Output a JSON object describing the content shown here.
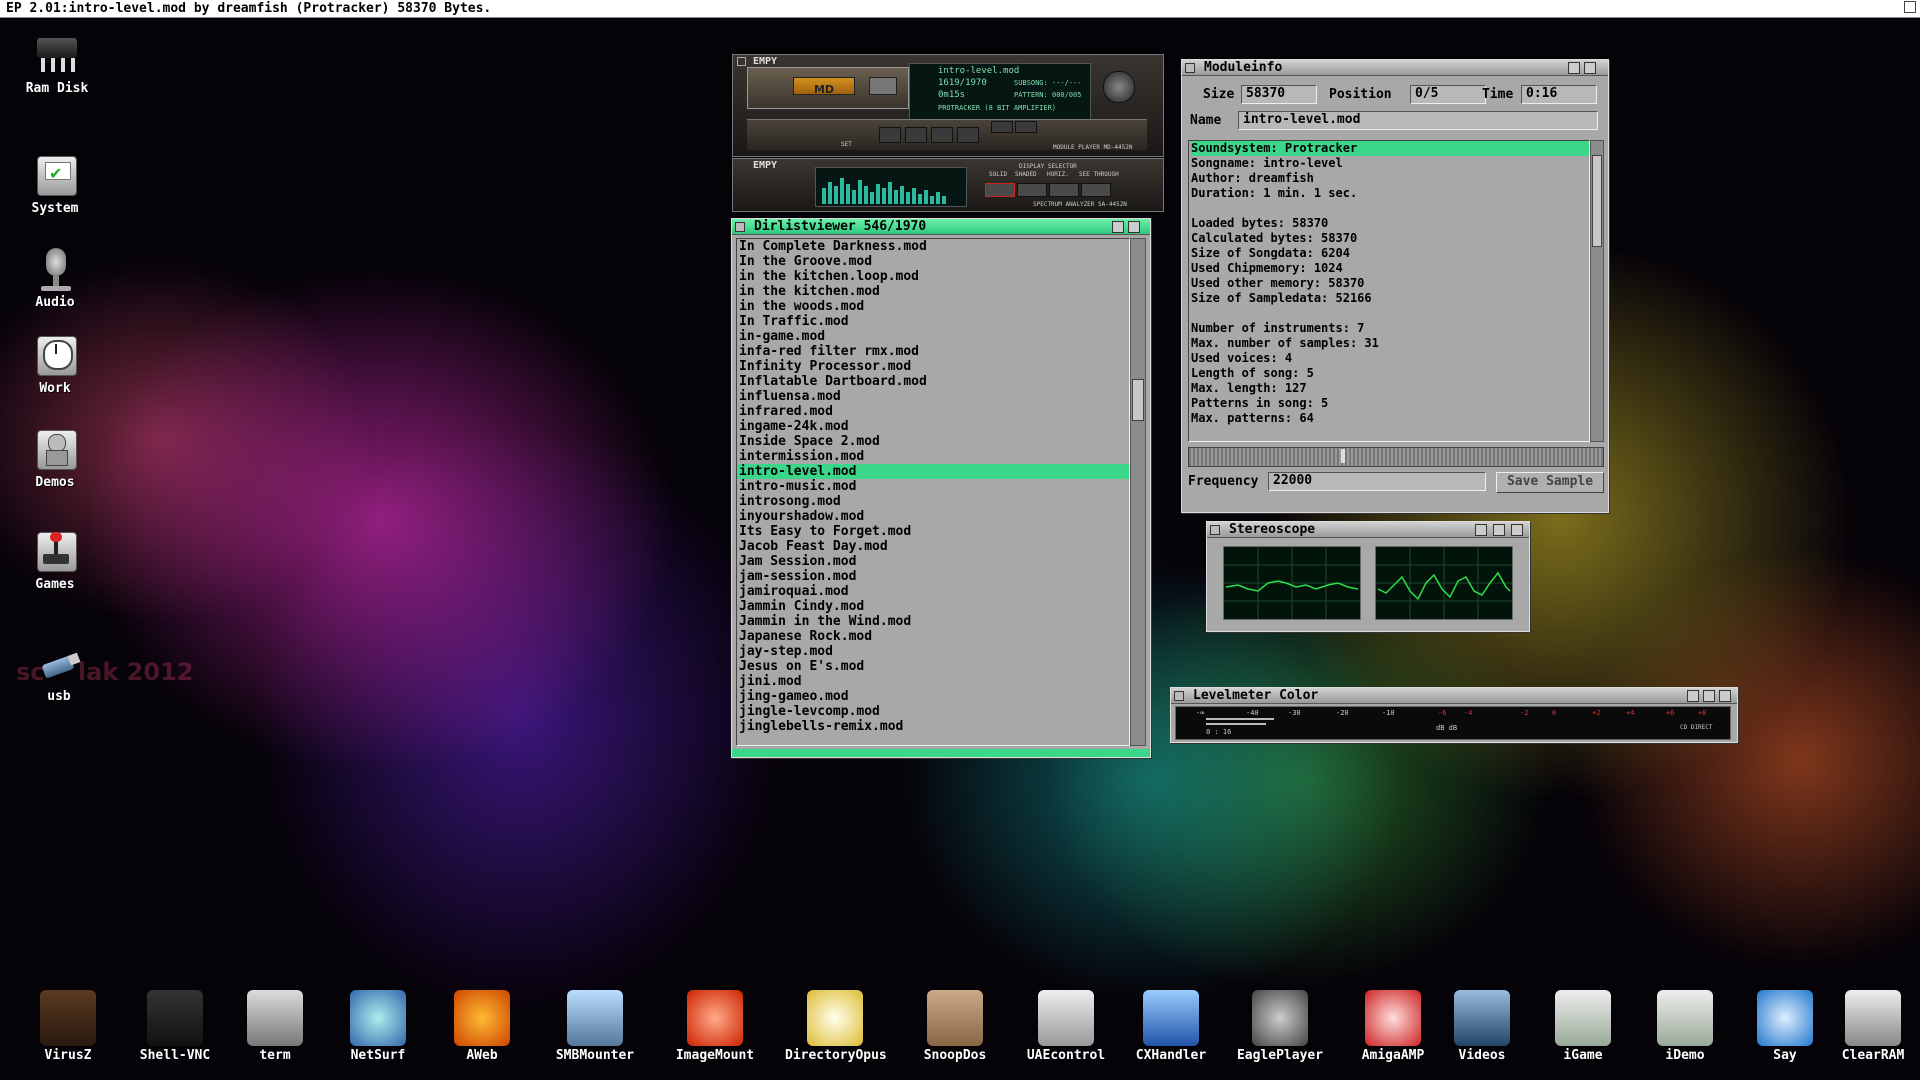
{
  "topbar": {
    "title": "EP 2.01:intro-level.mod by dreamfish (Protracker) 58370 Bytes."
  },
  "desktop_icons": [
    {
      "label": "Ram Disk",
      "icon": "chip-icon"
    },
    {
      "label": "System",
      "icon": "system-disk-icon"
    },
    {
      "label": "Audio",
      "icon": "microphone-icon"
    },
    {
      "label": "Work",
      "icon": "clock-drive-icon"
    },
    {
      "label": "Demos",
      "icon": "robot-icon"
    },
    {
      "label": "Games",
      "icon": "joystick-icon"
    },
    {
      "label": "usb",
      "icon": "usb-stick-icon"
    }
  ],
  "wallpaper_text": "sc    lak 2012",
  "dock": [
    {
      "label": "VirusZ"
    },
    {
      "label": "Shell-VNC"
    },
    {
      "label": "term"
    },
    {
      "label": "NetSurf"
    },
    {
      "label": "AWeb"
    },
    {
      "label": "SMBMounter"
    },
    {
      "label": "ImageMount"
    },
    {
      "label": "DirectoryOpus"
    },
    {
      "label": "SnoopDos"
    },
    {
      "label": "UAEcontrol"
    },
    {
      "label": "CXHandler"
    },
    {
      "label": "EaglePlayer"
    },
    {
      "label": "AmigaAMP"
    },
    {
      "label": "Videos"
    },
    {
      "label": "iGame"
    },
    {
      "label": "iDemo"
    },
    {
      "label": "Say"
    },
    {
      "label": "ClearRAM"
    }
  ],
  "player": {
    "brand": "EMPY",
    "md_label": "MD",
    "lcd_title": "intro-level.mod",
    "lcd_count": "1619/1970",
    "lcd_subsong_label": "SUBSONG:",
    "lcd_subsong": "---/---",
    "lcd_time": "0m15s",
    "lcd_pattern_label": "PATTERN:",
    "lcd_pattern": "000/005",
    "lcd_format": "PROTRACKER (8 BIT AMPLIFIER)",
    "model": "MODULE PLAYER MD-4452N",
    "analyzer_model": "SPECTRUM ANALYZER SA-4452N",
    "set_label": "SET",
    "display_select": "DISPLAY SELECTOR",
    "mode_labels": [
      "SOLID",
      "SHADED",
      "HORIZ.",
      "SEE THROUGH"
    ]
  },
  "dirlist": {
    "title": "Dirlistviewer 546/1970",
    "rows": [
      "In Complete Darkness.mod",
      "In the Groove.mod",
      "in the kitchen.loop.mod",
      "in the kitchen.mod",
      "in the woods.mod",
      "In Traffic.mod",
      "in-game.mod",
      "infa-red filter rmx.mod",
      "Infinity Processor.mod",
      "Inflatable Dartboard.mod",
      "influensa.mod",
      "infrared.mod",
      "ingame-24k.mod",
      "Inside Space 2.mod",
      "intermission.mod",
      "intro-level.mod",
      "intro-music.mod",
      "introsong.mod",
      "inyourshadow.mod",
      "Its Easy to Forget.mod",
      "Jacob Feast Day.mod",
      "Jam Session.mod",
      "jam-session.mod",
      "jamiroquai.mod",
      "Jammin Cindy.mod",
      "Jammin in the Wind.mod",
      "Japanese Rock.mod",
      "jay-step.mod",
      "Jesus on E's.mod",
      "jini.mod",
      "jing-gameo.mod",
      "jingle-levcomp.mod",
      "jinglebells-remix.mod"
    ],
    "selected_index": 15
  },
  "moduleinfo": {
    "title": "Moduleinfo",
    "size_label": "Size",
    "size": "58370",
    "position_label": "Position",
    "position": "0/5",
    "time_label": "Time",
    "time": "0:16",
    "name_label": "Name",
    "name": "intro-level.mod",
    "info_lines": [
      "Soundsystem: Protracker",
      "Songname: intro-level",
      "Author: dreamfish",
      "Duration: 1 min. 1 sec.",
      "",
      "Loaded bytes: 58370",
      "Calculated bytes: 58370",
      "Size of Songdata: 6204",
      "Used Chipmemory: 1024",
      "Used other memory: 58370",
      "Size of Sampledata: 52166",
      "",
      "Number of instruments: 7",
      "Max. number of samples: 31",
      "Used voices: 4",
      "Length of song: 5",
      "Max. length: 127",
      "Patterns in song: 5",
      "Max. patterns: 64"
    ],
    "selected_line": 0,
    "frequency_label": "Frequency",
    "frequency": "22000",
    "save_button": "Save Sample"
  },
  "stereoscope": {
    "title": "Stereoscope"
  },
  "levelmeter": {
    "title": "Levelmeter Color",
    "scale": [
      "-∞",
      "-40",
      "-30",
      "-20",
      "-10",
      "-6",
      "-4",
      "-2",
      "0",
      "+2",
      "+4",
      "+6",
      "+8"
    ],
    "footer_left": "0 : 16",
    "footer_mid": "dB dB",
    "footer_right": "CD DIRECT"
  },
  "colors": {
    "selection": "#3ad78a",
    "window": "#a8a8a8",
    "scope_trace": "#2fdc4a"
  }
}
